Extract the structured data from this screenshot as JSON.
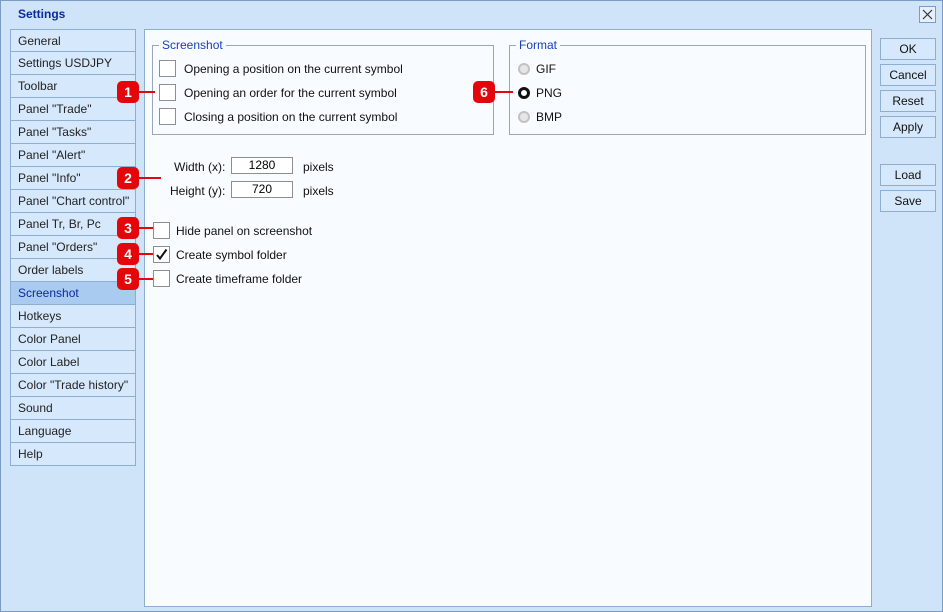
{
  "window": {
    "title": "Settings"
  },
  "sidebar": {
    "items": [
      {
        "label": "General"
      },
      {
        "label": "Settings USDJPY"
      },
      {
        "label": "Toolbar"
      },
      {
        "label": "Panel \"Trade\""
      },
      {
        "label": "Panel \"Tasks\""
      },
      {
        "label": "Panel \"Alert\""
      },
      {
        "label": "Panel \"Info\""
      },
      {
        "label": "Panel \"Chart control\""
      },
      {
        "label": "Panel Tr, Br, Pc"
      },
      {
        "label": "Panel \"Orders\""
      },
      {
        "label": "Order labels"
      },
      {
        "label": "Screenshot"
      },
      {
        "label": "Hotkeys"
      },
      {
        "label": "Color Panel"
      },
      {
        "label": "Color Label"
      },
      {
        "label": "Color \"Trade history\""
      },
      {
        "label": "Sound"
      },
      {
        "label": "Language"
      },
      {
        "label": "Help"
      }
    ],
    "active_index": 11
  },
  "screenshot_group": {
    "legend": "Screenshot",
    "options": [
      {
        "label": "Opening a position on the current symbol",
        "checked": false
      },
      {
        "label": "Opening an order for the current symbol",
        "checked": false
      },
      {
        "label": "Closing a position on the current symbol",
        "checked": false
      }
    ]
  },
  "format_group": {
    "legend": "Format",
    "options": [
      {
        "label": "GIF",
        "selected": false
      },
      {
        "label": "PNG",
        "selected": true
      },
      {
        "label": "BMP",
        "selected": false
      }
    ]
  },
  "size": {
    "width_label": "Width (x):",
    "width_value": "1280",
    "height_label": "Height (y):",
    "height_value": "720",
    "unit": "pixels"
  },
  "options": [
    {
      "label": "Hide panel on screenshot",
      "checked": false
    },
    {
      "label": "Create symbol folder",
      "checked": true
    },
    {
      "label": "Create timeframe folder",
      "checked": false
    }
  ],
  "buttons": {
    "ok": "OK",
    "cancel": "Cancel",
    "reset": "Reset",
    "apply": "Apply",
    "load": "Load",
    "save": "Save"
  },
  "callouts": [
    "1",
    "2",
    "3",
    "4",
    "5",
    "6"
  ],
  "colors": {
    "window_bg": "#cfe4f9",
    "panel_bg": "#f8fbff",
    "accent_text": "#1a3fb8",
    "active_item_bg": "#a9cbf0",
    "callout": "#e3060a"
  },
  "icons": {
    "close": "close-icon",
    "check": "checkmark-icon"
  }
}
